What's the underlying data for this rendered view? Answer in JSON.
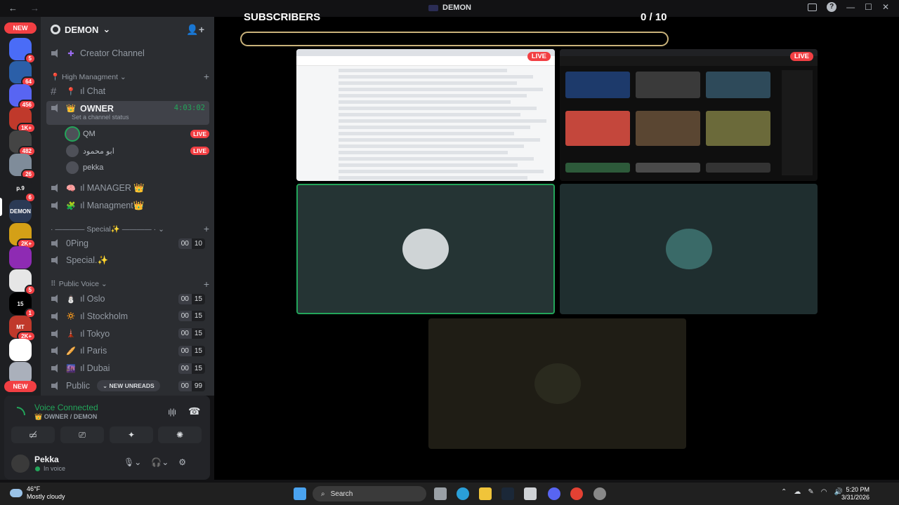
{
  "window": {
    "title": "DEMON",
    "back": "←",
    "forward": "→",
    "minimize": "—",
    "maximize": "☐",
    "close": "✕"
  },
  "guilds": {
    "items": [
      {
        "badge": "5",
        "color": "#4a6cf7"
      },
      {
        "badge": "64",
        "color": "#2b5fa8"
      },
      {
        "badge": "456",
        "color": "#5865f2"
      },
      {
        "badge": "1K+",
        "color": "#c0392b"
      },
      {
        "badge": "482",
        "color": "#444444"
      },
      {
        "badge": "26",
        "color": "#7f8c9a"
      },
      {
        "badge": "6",
        "color": "#1e1f22",
        "label": "p.9"
      },
      {
        "badge": "",
        "color": "#2b3a55",
        "label": "DEMON"
      },
      {
        "badge": "2K+",
        "color": "#d4a017"
      },
      {
        "badge": "",
        "color": "#8e2bb3"
      },
      {
        "badge": "5",
        "color": "#e6e6e6"
      },
      {
        "badge": "1",
        "color": "#000000",
        "label": "15"
      },
      {
        "badge": "2K+",
        "color": "#c0392b",
        "label": "MT"
      },
      {
        "badge": "",
        "color": "#ffffff"
      },
      {
        "badge": "",
        "color": "#aab0bb"
      }
    ],
    "new_top": "NEW",
    "new_bottom": "NEW"
  },
  "server": {
    "name": "DEMON",
    "chevron": "⌄"
  },
  "channels": {
    "creator": "Creator Channel",
    "cat_high": "📍 High Managment ⌄",
    "chat": "ıl Chat",
    "owner": {
      "name": "OWNER",
      "timer": "4:03:02",
      "status": "Set a channel status"
    },
    "members": [
      {
        "name": "QM",
        "live": "LIVE"
      },
      {
        "name": "ابو محمود",
        "live": "LIVE"
      },
      {
        "name": "pekka",
        "live": ""
      }
    ],
    "manager": "ıl MANAGER 👑",
    "managment": "ıl Managment👑",
    "cat_special": "· ———— Special✨ ———— · ⌄",
    "oping": {
      "name": "0Ping",
      "a": "00",
      "b": "10"
    },
    "special": {
      "name": "Special.✨"
    },
    "cat_public": "Public Voice ⌄",
    "voice": [
      {
        "name": "ıl Oslo",
        "emo": "⛄",
        "a": "00",
        "b": "15"
      },
      {
        "name": "ıl Stockholm",
        "emo": "🔅",
        "a": "00",
        "b": "15"
      },
      {
        "name": "ıl Tokyo",
        "emo": "🗼",
        "a": "00",
        "b": "15"
      },
      {
        "name": "ıl Paris",
        "emo": "🥖",
        "a": "00",
        "b": "15"
      },
      {
        "name": "ıl Dubai",
        "emo": "🌆",
        "a": "00",
        "b": "15"
      },
      {
        "name": "Public",
        "emo": "",
        "a": "00",
        "b": "99"
      }
    ],
    "new_unreads": "⌄ NEW UNREADS"
  },
  "voice_panel": {
    "title": "Voice Connected",
    "sub": "👑 OWNER / DEMON"
  },
  "user": {
    "name": "Pekka",
    "status": "In voice"
  },
  "stage": {
    "subs_title": "SUBSCRIBERS",
    "subs_count": "0 / 10",
    "subs_progress": 0,
    "live1": "LIVE",
    "live2": "LIVE"
  },
  "taskbar": {
    "temp": "46°F",
    "weather": "Mostly cloudy",
    "weather_badge": "2",
    "search": "Search",
    "time": "5:20 PM",
    "date": "3/31/2026"
  }
}
